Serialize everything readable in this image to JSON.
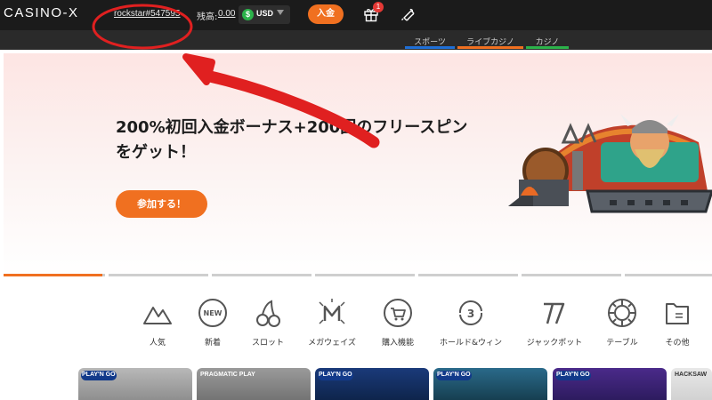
{
  "header": {
    "logo": "CASINO-X",
    "username": "rockstar#547595",
    "balance_label": "残高:",
    "balance_value": "0.00",
    "currency_symbol": "$",
    "currency_code": "USD",
    "deposit_label": "入金",
    "gift_badge": "1"
  },
  "subnav": {
    "tabs": [
      {
        "label": "スポーツ",
        "color": "#1f6fd6"
      },
      {
        "label": "ライブカジノ",
        "color": "#f07020"
      },
      {
        "label": "カジノ",
        "color": "#2bb34a"
      }
    ]
  },
  "hero": {
    "title": "200%初回入金ボーナス+200回のフリースピンをゲット！",
    "cta_label": "参加する！",
    "slide_progress": 0.14
  },
  "categories": [
    {
      "label": "人気",
      "icon": "mountain-icon"
    },
    {
      "label": "新着",
      "icon": "new-badge-icon"
    },
    {
      "label": "スロット",
      "icon": "cherry-icon"
    },
    {
      "label": "メガウェイズ",
      "icon": "megaways-icon"
    },
    {
      "label": "購入機能",
      "icon": "cart-icon"
    },
    {
      "label": "ホールド&ウィン",
      "icon": "hold-win-icon"
    },
    {
      "label": "ジャックポット",
      "icon": "jackpot-777-icon"
    },
    {
      "label": "テーブル",
      "icon": "poker-chip-icon"
    },
    {
      "label": "その他",
      "icon": "folder-icon"
    }
  ],
  "games": [
    {
      "provider": "PLAY'N GO"
    },
    {
      "provider": "PRAGMATIC PLAY"
    },
    {
      "provider": "PLAY'N GO"
    },
    {
      "provider": "PLAY'N GO"
    },
    {
      "provider": "PLAY'N GO"
    },
    {
      "provider": "HACKSAW"
    }
  ],
  "colors": {
    "accent": "#f07020",
    "topbar": "#1b1b1b",
    "annotation": "#e02020"
  }
}
